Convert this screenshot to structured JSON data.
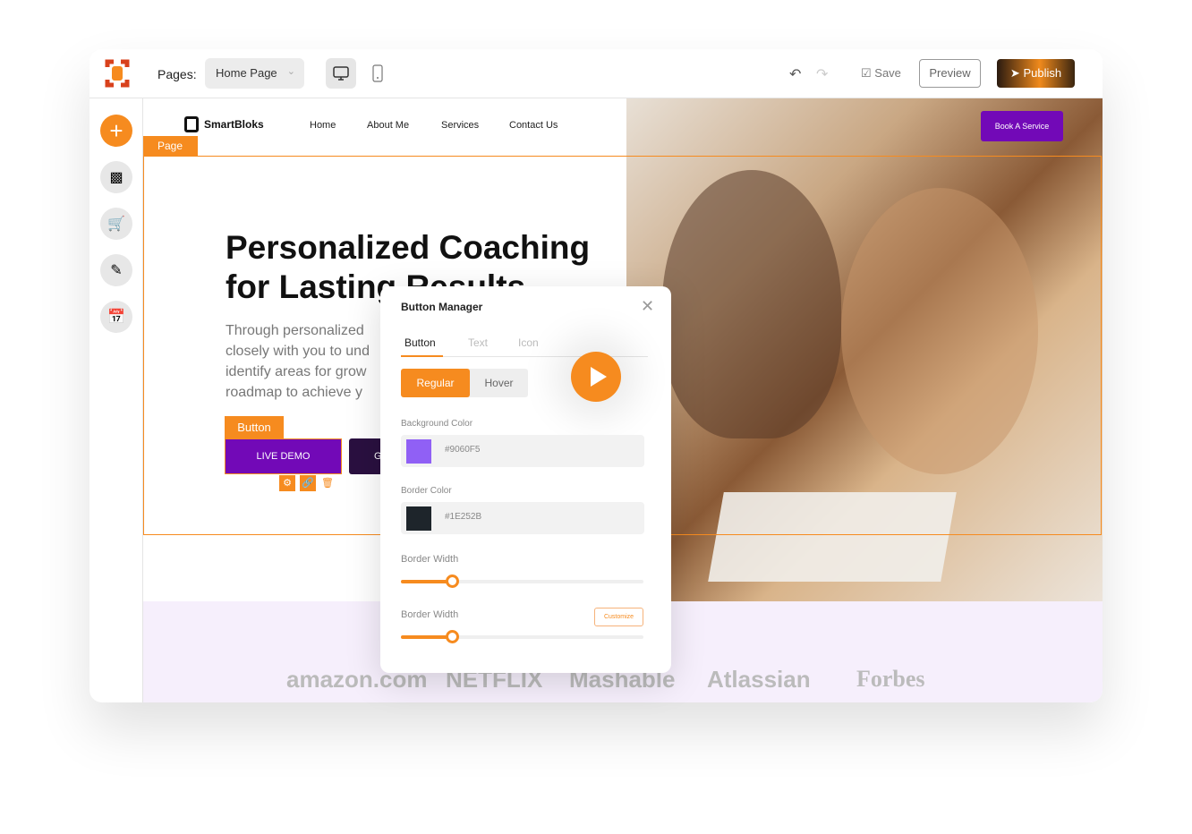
{
  "topbar": {
    "pages_label": "Pages:",
    "page_select": "Home Page",
    "save": "Save",
    "preview": "Preview",
    "publish": "Publish"
  },
  "site": {
    "brand": "SmartBloks",
    "nav": [
      "Home",
      "About Me",
      "Services",
      "Contact Us"
    ],
    "cta": "Book A Service",
    "page_tag": "Page",
    "headline": "Personalized Coaching for Lasting Results",
    "paragraph": [
      "Through personalized",
      "closely with you to und",
      "identify areas for grow",
      "roadmap to achieve y"
    ],
    "button_tag": "Button",
    "primary_button": "LIVE DEMO",
    "secondary_button": "G",
    "logos": [
      "amazon.com",
      "NETFLIX",
      "Mashable",
      "Atlassian",
      "Forbes"
    ]
  },
  "modal": {
    "title": "Button Manager",
    "tabs": [
      "Button",
      "Text",
      "Icon"
    ],
    "states": [
      "Regular",
      "Hover"
    ],
    "bg_label": "Background Color",
    "bg_value": "#9060F5",
    "border_label": "Border Color",
    "border_value": "#1E252B",
    "width_label_1": "Border Width",
    "width_label_2": "Border Width",
    "customize": "Customize",
    "slider1_percent": 21,
    "slider2_percent": 21
  },
  "colors": {
    "accent": "#F68B1F",
    "purple": "#7209B7"
  }
}
